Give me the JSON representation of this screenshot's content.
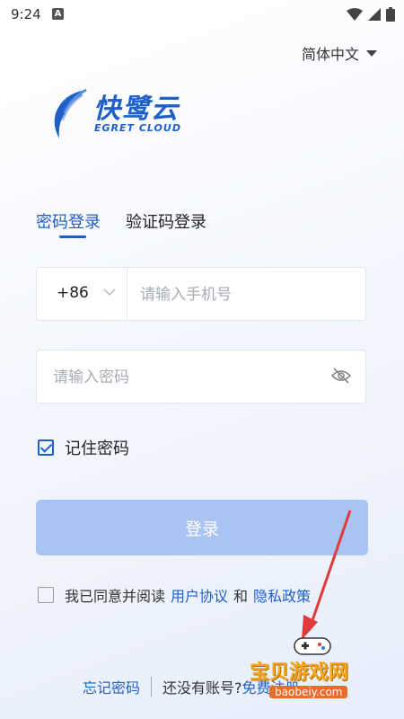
{
  "status": {
    "time": "9:24",
    "notification_icon": "A"
  },
  "language": {
    "label": "简体中文"
  },
  "logo": {
    "cn": "快鹭云",
    "en": "EGRET CLOUD"
  },
  "tabs": [
    {
      "label": "密码登录",
      "active": true
    },
    {
      "label": "验证码登录",
      "active": false
    }
  ],
  "phone": {
    "country_code": "+86",
    "placeholder": "请输入手机号"
  },
  "password": {
    "placeholder": "请输入密码"
  },
  "remember": {
    "label": "记住密码",
    "checked": true
  },
  "login": {
    "label": "登录"
  },
  "agreement": {
    "prefix": "我已同意并阅读",
    "user_agreement": "用户协议",
    "and": "和",
    "privacy_policy": "隐私政策"
  },
  "footer": {
    "forgot": "忘记密码",
    "no_account": "还没有账号?",
    "register": "免费注册"
  },
  "watermark": {
    "text": "宝贝游戏网",
    "url": "baobeiy.com"
  },
  "colors": {
    "primary": "#1f5fc8",
    "button_disabled": "#a9c3f2"
  }
}
